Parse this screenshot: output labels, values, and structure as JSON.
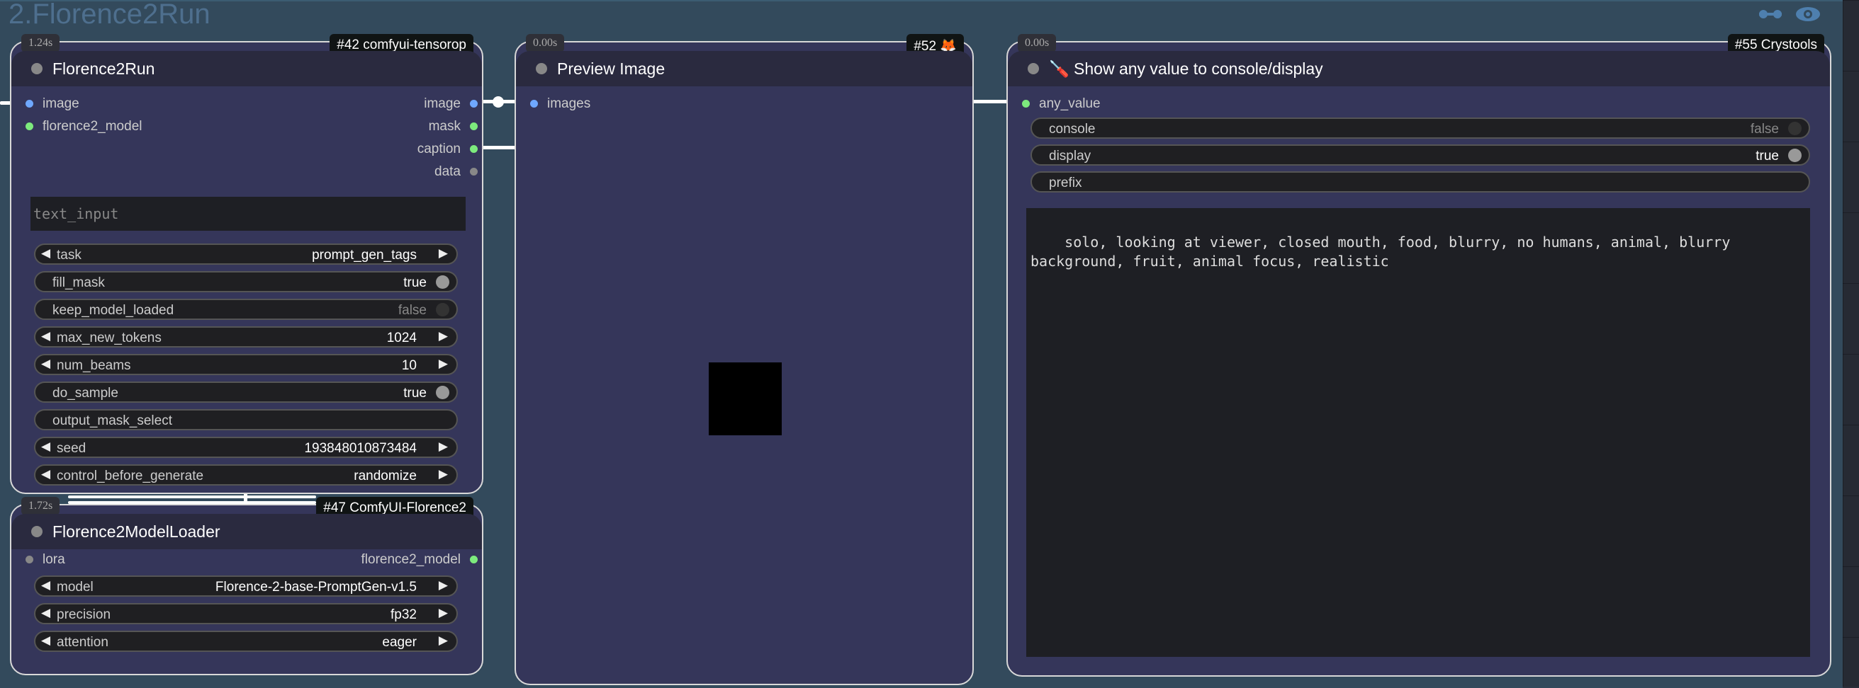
{
  "group": {
    "title": "2.Florence2Run"
  },
  "nodes": {
    "florence2run": {
      "timing": "1.24s",
      "badge": "#42 comfyui-tensorop",
      "title": "Florence2Run",
      "inputs": [
        "image",
        "florence2_model"
      ],
      "outputs": [
        "image",
        "mask",
        "caption",
        "data"
      ],
      "text_input_placeholder": "text_input",
      "widgets": {
        "task": {
          "label": "task",
          "value": "prompt_gen_tags"
        },
        "fill_mask": {
          "label": "fill_mask",
          "value": "true"
        },
        "keep_model_loaded": {
          "label": "keep_model_loaded",
          "value": "false"
        },
        "max_new_tokens": {
          "label": "max_new_tokens",
          "value": "1024"
        },
        "num_beams": {
          "label": "num_beams",
          "value": "10"
        },
        "do_sample": {
          "label": "do_sample",
          "value": "true"
        },
        "output_mask_select": {
          "label": "output_mask_select",
          "value": ""
        },
        "seed": {
          "label": "seed",
          "value": "193848010873484"
        },
        "control_before_generate": {
          "label": "control_before_generate",
          "value": "randomize"
        }
      }
    },
    "modelloader": {
      "timing": "1.72s",
      "badge": "#47 ComfyUI-Florence2",
      "title": "Florence2ModelLoader",
      "inputs": [
        "lora"
      ],
      "outputs": [
        "florence2_model"
      ],
      "widgets": {
        "model": {
          "label": "model",
          "value": "Florence-2-base-PromptGen-v1.5"
        },
        "precision": {
          "label": "precision",
          "value": "fp32"
        },
        "attention": {
          "label": "attention",
          "value": "eager"
        }
      }
    },
    "preview": {
      "timing": "0.00s",
      "badge": "#52 🦊",
      "title": "Preview Image",
      "inputs": [
        "images"
      ]
    },
    "showany": {
      "timing": "0.00s",
      "badge": "#55 Crystools",
      "title_icon": "🪛",
      "title": "Show any value to console/display",
      "inputs": [
        "any_value"
      ],
      "widgets": {
        "console": {
          "label": "console",
          "value": "false"
        },
        "display": {
          "label": "display",
          "value": "true"
        },
        "prefix": {
          "label": "prefix",
          "value": ""
        }
      },
      "output_text": "solo, looking at viewer, closed mouth, food, blurry, no humans, animal, blurry\nbackground, fruit, animal focus, realistic"
    }
  },
  "icons": [
    "link-icon",
    "eye-icon"
  ]
}
